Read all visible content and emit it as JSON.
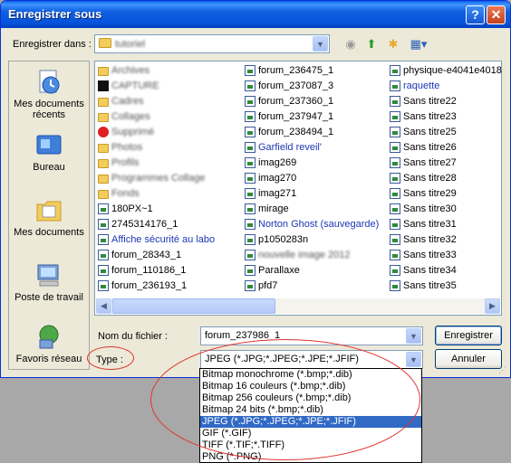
{
  "window": {
    "title": "Enregistrer sous",
    "help_btn": "?",
    "close_btn": "✕"
  },
  "save_in": {
    "label": "Enregistrer dans :",
    "value": "tutoriel"
  },
  "places": [
    {
      "label": "Mes documents récents",
      "icon": "recent-documents-icon"
    },
    {
      "label": "Bureau",
      "icon": "desktop-icon"
    },
    {
      "label": "Mes documents",
      "icon": "my-documents-icon"
    },
    {
      "label": "Poste de travail",
      "icon": "my-computer-icon"
    },
    {
      "label": "Favoris réseau",
      "icon": "network-places-icon"
    }
  ],
  "files": {
    "col1": [
      {
        "name": "Archives",
        "type": "folder",
        "blurred": true
      },
      {
        "name": "CAPTURE",
        "type": "black",
        "blurred": true
      },
      {
        "name": "Cadres",
        "type": "folder",
        "blurred": true
      },
      {
        "name": "Collages",
        "type": "folder",
        "blurred": true
      },
      {
        "name": "Supprimé",
        "type": "stop",
        "blurred": true
      },
      {
        "name": "Photos",
        "type": "folder",
        "blurred": true
      },
      {
        "name": "Profils",
        "type": "folder",
        "blurred": true
      },
      {
        "name": "Programmes Collage",
        "type": "folder",
        "blurred": true
      },
      {
        "name": "Fonds",
        "type": "folder",
        "blurred": true
      },
      {
        "name": "180PX~1",
        "type": "img"
      },
      {
        "name": "2745314176_1",
        "type": "img"
      },
      {
        "name": "Affiche sécurité au labo",
        "type": "img",
        "blue": true
      },
      {
        "name": "forum_28343_1",
        "type": "img"
      },
      {
        "name": "forum_110186_1",
        "type": "img"
      },
      {
        "name": "forum_236193_1",
        "type": "img"
      }
    ],
    "col2": [
      {
        "name": "forum_236475_1",
        "type": "img"
      },
      {
        "name": "forum_237087_3",
        "type": "img"
      },
      {
        "name": "forum_237360_1",
        "type": "img"
      },
      {
        "name": "forum_237947_1",
        "type": "img"
      },
      {
        "name": "forum_238494_1",
        "type": "img"
      },
      {
        "name": "Garfield reveil'",
        "type": "img",
        "blue": true
      },
      {
        "name": "imag269",
        "type": "img"
      },
      {
        "name": "imag270",
        "type": "img"
      },
      {
        "name": "imag271",
        "type": "img"
      },
      {
        "name": "mirage",
        "type": "img"
      },
      {
        "name": "Norton Ghost (sauvegarde)",
        "type": "img",
        "blue": true
      },
      {
        "name": "p1050283n",
        "type": "img"
      },
      {
        "name": "nouvelle image 2012",
        "type": "img",
        "blurred": true
      },
      {
        "name": "Parallaxe",
        "type": "img"
      },
      {
        "name": "pfd7",
        "type": "img"
      }
    ],
    "col3": [
      {
        "name": "physique-e4041e4018",
        "type": "img"
      },
      {
        "name": "raquette",
        "type": "img",
        "blue": true
      },
      {
        "name": "Sans titre22",
        "type": "img"
      },
      {
        "name": "Sans titre23",
        "type": "img"
      },
      {
        "name": "Sans titre25",
        "type": "img"
      },
      {
        "name": "Sans titre26",
        "type": "img"
      },
      {
        "name": "Sans titre27",
        "type": "img"
      },
      {
        "name": "Sans titre28",
        "type": "img"
      },
      {
        "name": "Sans titre29",
        "type": "img"
      },
      {
        "name": "Sans titre30",
        "type": "img"
      },
      {
        "name": "Sans titre31",
        "type": "img"
      },
      {
        "name": "Sans titre32",
        "type": "img"
      },
      {
        "name": "Sans titre33",
        "type": "img"
      },
      {
        "name": "Sans titre34",
        "type": "img"
      },
      {
        "name": "Sans titre35",
        "type": "img"
      }
    ]
  },
  "filename": {
    "label": "Nom du fichier :",
    "value": "forum_237986_1"
  },
  "filetype": {
    "label": "Type :",
    "value": "JPEG (*.JPG;*.JPEG;*.JPE;*.JFIF)",
    "options": [
      "Bitmap monochrome (*.bmp;*.dib)",
      "Bitmap 16 couleurs (*.bmp;*.dib)",
      "Bitmap 256 couleurs (*.bmp;*.dib)",
      "Bitmap 24 bits (*.bmp;*.dib)",
      "JPEG (*.JPG;*.JPEG;*.JPE;*.JFIF)",
      "GIF (*.GIF)",
      "TIFF (*.TIF;*.TIFF)",
      "PNG (*.PNG)"
    ],
    "selected_index": 4
  },
  "buttons": {
    "save": "Enregistrer",
    "cancel": "Annuler"
  },
  "colors": {
    "titlebar": "#0554dc",
    "selection": "#316ac5",
    "annotation": "#e0342c"
  }
}
